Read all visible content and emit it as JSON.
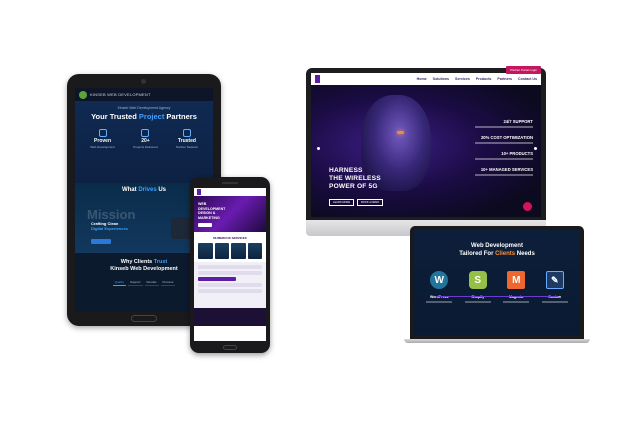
{
  "tablet": {
    "nav_brand": "KINSEB WEB DEVELOPMENT",
    "hero_kicker": "Kinseb Web Development Agency",
    "hero_title_a": "Your Trusted ",
    "hero_title_b": "Project",
    "hero_title_c": " Partners",
    "stats": [
      {
        "value": "Proven",
        "label": "Web Development"
      },
      {
        "value": "20+",
        "label": "Projects Delivered"
      },
      {
        "value": "Trusted",
        "label": "Partner Network"
      }
    ],
    "drives_a": "What ",
    "drives_b": "Drives",
    "drives_c": " Us",
    "mission_word": "Mission",
    "mission_line_a": "Crafting Clean ",
    "mission_line_b": "Digital Experiences",
    "why_a": "Why Clients ",
    "why_b": "Trust",
    "why_c": "Kinseb Web Development",
    "tabs": [
      "Quality",
      "Support",
      "Results",
      "Process"
    ]
  },
  "phone": {
    "hero_text": "WEB DEVELOPMENT DESIGN & MARKETING",
    "services_title": "NUMEROUS SERVICES"
  },
  "monitor": {
    "menu": [
      "Home",
      "Solutions",
      "Services",
      "Products",
      "Partners",
      "Contact Us"
    ],
    "cta": "Partner Portal Login",
    "headline_1": "HARNESS",
    "headline_2": "THE WIRELESS",
    "headline_3": "POWER OF 5G",
    "btn_1": "LEARN MORE",
    "btn_2": "BOOK A DEMO",
    "list": [
      "24/7 SUPPORT",
      "20% COST OPTIMIZATION",
      "10+ PRODUCTS",
      "10+ MANAGED SERVICES"
    ]
  },
  "laptop": {
    "title_1": "Web Development",
    "title_2a": "Tailored For ",
    "title_2b": "Clients",
    "title_2c": " Needs",
    "platforms": [
      {
        "name": "WordPress",
        "icon": "wordpress-icon",
        "glyph": "W",
        "color": "#21759b"
      },
      {
        "name": "Shopify",
        "icon": "shopify-icon",
        "glyph": "S",
        "color": "#95bf47"
      },
      {
        "name": "Magento",
        "icon": "magento-icon",
        "glyph": "M",
        "color": "#ee672f"
      },
      {
        "name": "Custom",
        "icon": "custom-code-icon",
        "glyph": "✎",
        "color": "#1c3a63"
      }
    ]
  }
}
